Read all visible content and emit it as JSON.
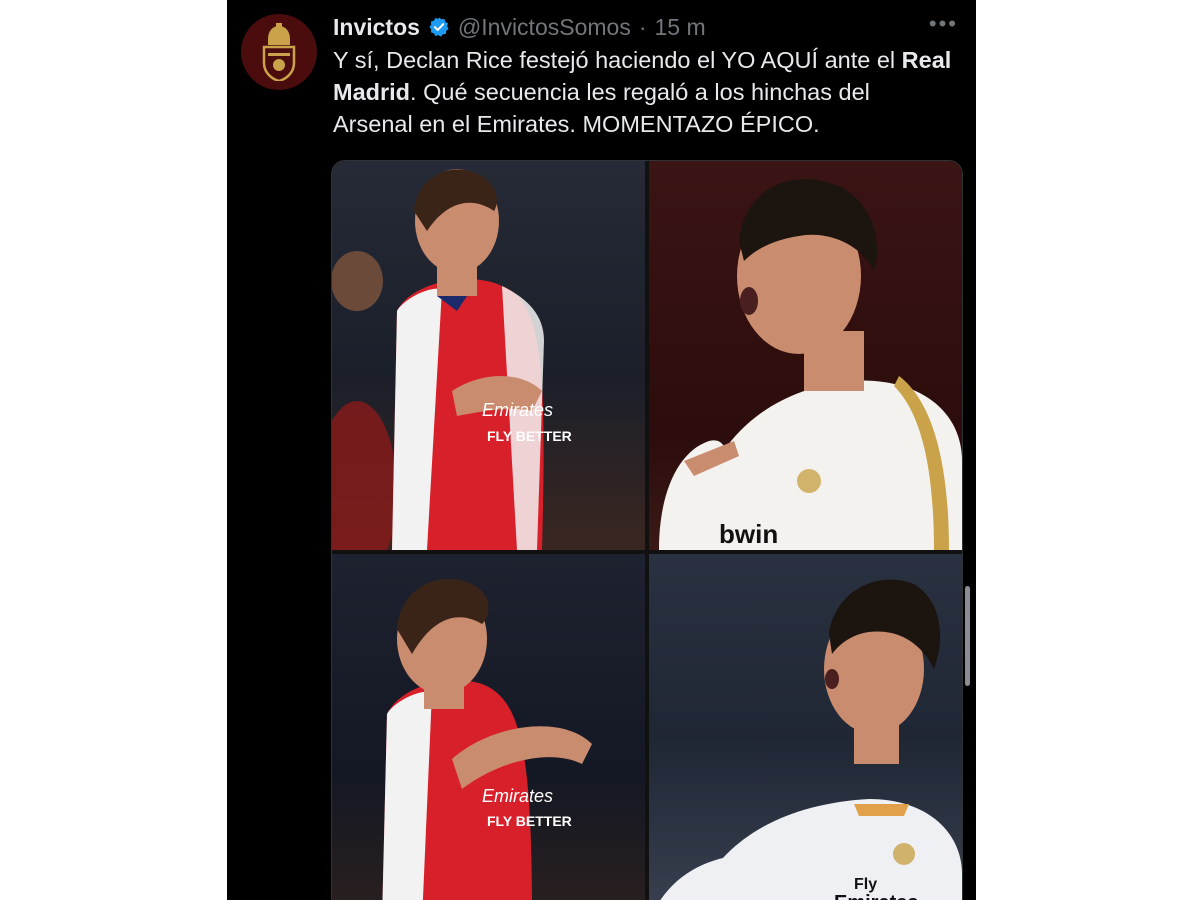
{
  "tweet": {
    "author_name": "Invictos",
    "verified": true,
    "handle": "@InvictosSomos",
    "separator": "·",
    "time": "15 m",
    "more_icon": "more-horizontal-icon",
    "text_part1": "Y sí, Declan Rice festejó haciendo el YO AQUÍ ante el ",
    "text_bold": "Real Madrid",
    "text_part2": ". Qué secuencia les regaló a los hinchas del Arsenal en el Emirates. MOMENTAZO ÉPICO."
  },
  "media": {
    "images": [
      {
        "name": "declan-rice-photo-1",
        "sponsor_text": "Emirates FLY BETTER"
      },
      {
        "name": "cristiano-ronaldo-photo-1",
        "sponsor_text": "bwin"
      },
      {
        "name": "declan-rice-photo-2",
        "sponsor_text": "Emirates FLY BETTER"
      },
      {
        "name": "cristiano-ronaldo-photo-2",
        "sponsor_text": "Fly Emirates"
      }
    ]
  },
  "colors": {
    "background": "#000000",
    "text_primary": "#e7e9ea",
    "text_secondary": "#71767b",
    "verified_badge": "#1d9bf0",
    "avatar_bg": "#4a0c0c",
    "avatar_gold": "#c9a24a"
  }
}
